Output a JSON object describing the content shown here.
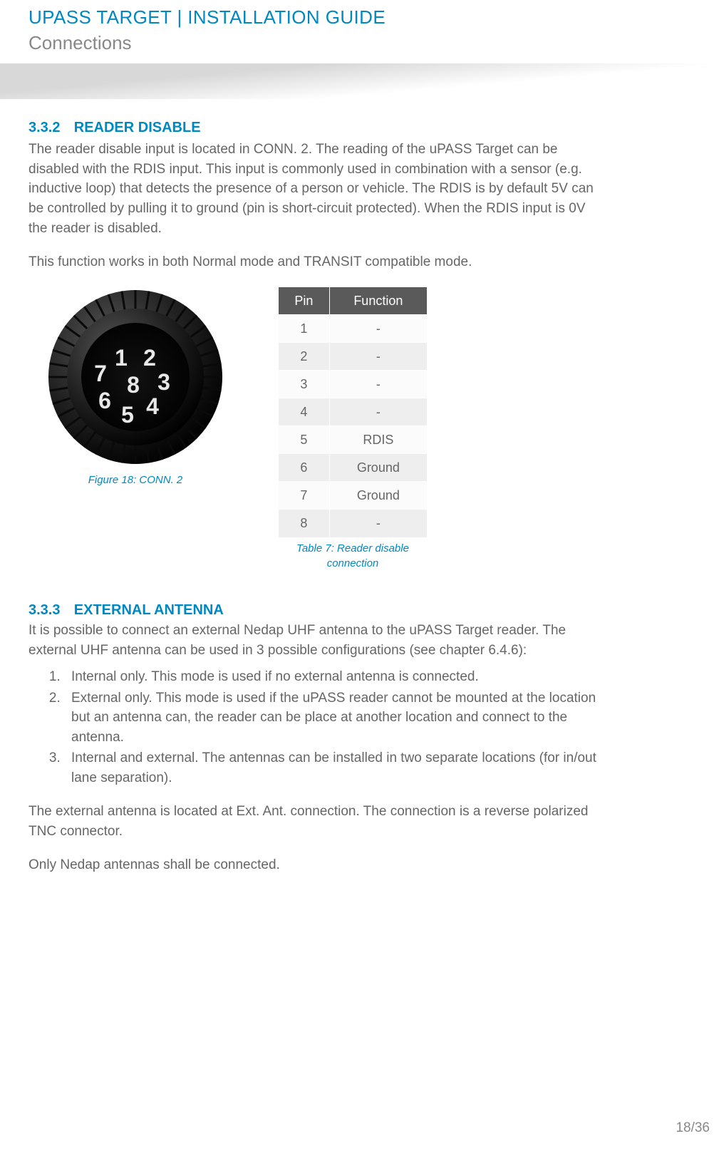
{
  "header": {
    "title": "UPASS TARGET | INSTALLATION GUIDE",
    "subtitle": "Connections"
  },
  "sec1": {
    "num": "3.3.2",
    "title": "READER DISABLE",
    "p1": "The reader disable input is located in CONN. 2. The reading of the uPASS Target can be disabled with the RDIS input. This input is commonly used in combination with a sensor (e.g. inductive loop) that detects the presence of a person or vehicle. The RDIS is by default 5V can be controlled by pulling it to ground (pin is short-circuit protected). When the RDIS input is 0V the reader is disabled.",
    "p2": "This function works in both Normal mode and TRANSIT compatible mode."
  },
  "figure": {
    "caption": "Figure 18: CONN. 2",
    "pins": [
      "1",
      "2",
      "3",
      "4",
      "5",
      "6",
      "7",
      "8"
    ]
  },
  "table": {
    "head": [
      "Pin",
      "Function"
    ],
    "rows": [
      {
        "pin": "1",
        "fn": "-"
      },
      {
        "pin": "2",
        "fn": "-"
      },
      {
        "pin": "3",
        "fn": "-"
      },
      {
        "pin": "4",
        "fn": "-"
      },
      {
        "pin": "5",
        "fn": "RDIS"
      },
      {
        "pin": "6",
        "fn": "Ground"
      },
      {
        "pin": "7",
        "fn": "Ground"
      },
      {
        "pin": "8",
        "fn": "-"
      }
    ],
    "caption": "Table 7: Reader disable connection"
  },
  "sec2": {
    "num": "3.3.3",
    "title": "EXTERNAL ANTENNA",
    "p1": "It is possible to connect an external Nedap UHF antenna to the uPASS Target reader. The external UHF antenna can be used in 3 possible configurations (see chapter 6.4.6):",
    "li1": "Internal only. This mode is used if no external antenna is connected.",
    "li2": "External only. This mode is used if the uPASS reader cannot be mounted at the location but an antenna can, the reader can be place at another location and connect to the antenna.",
    "li3": "Internal and external. The antennas can be installed in two separate locations (for in/out lane separation).",
    "p2": "The external antenna is located at Ext. Ant. connection. The connection is a reverse polarized TNC connector.",
    "p3": "Only Nedap antennas shall be connected."
  },
  "page": "18/36"
}
